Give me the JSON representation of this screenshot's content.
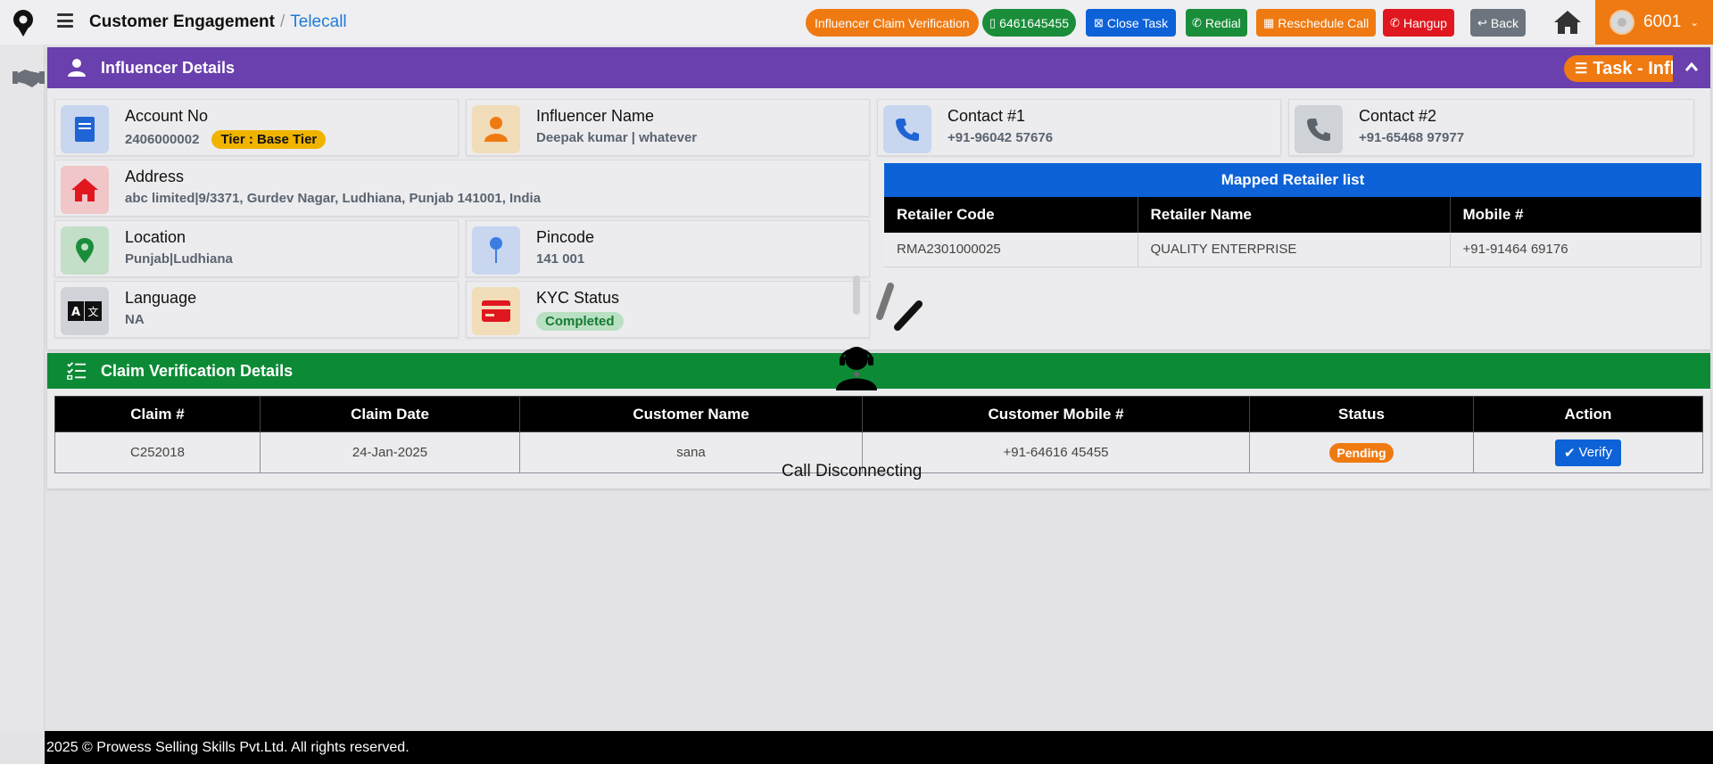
{
  "header": {
    "title": "Customer Engagement",
    "separator": "/",
    "subtitle": "Telecall",
    "buttons": {
      "influencer_claim": "Influencer Claim Verification",
      "phone": "6461645455",
      "close_task": "Close Task",
      "redial": "Redial",
      "reschedule": "Reschedule Call",
      "hangup": "Hangup",
      "back": "Back"
    },
    "user_id": "6001"
  },
  "influencer_panel": {
    "title": "Influencer Details",
    "task_label": "Task - Infl",
    "cards": {
      "account_no": {
        "title": "Account No",
        "value": "2406000002",
        "tier": "Tier : Base Tier"
      },
      "influencer_name": {
        "title": "Influencer Name",
        "value": "Deepak kumar | whatever"
      },
      "contact1": {
        "title": "Contact #1",
        "value": "+91-96042 57676"
      },
      "contact2": {
        "title": "Contact #2",
        "value": "+91-65468 97977"
      },
      "address": {
        "title": "Address",
        "value": "abc limited|9/3371, Gurdev Nagar, Ludhiana, Punjab 141001, India"
      },
      "location": {
        "title": "Location",
        "value": "Punjab|Ludhiana"
      },
      "pincode": {
        "title": "Pincode",
        "value": "141 001"
      },
      "language": {
        "title": "Language",
        "value": "NA"
      },
      "kyc": {
        "title": "KYC Status",
        "value": "Completed"
      }
    },
    "retailer_table": {
      "caption": "Mapped Retailer list",
      "headers": [
        "Retailer Code",
        "Retailer Name",
        "Mobile #"
      ],
      "rows": [
        [
          "RMA2301000025",
          "QUALITY ENTERPRISE",
          "+91-91464 69176"
        ]
      ]
    }
  },
  "claim_panel": {
    "title": "Claim Verification Details",
    "headers": [
      "Claim #",
      "Claim Date",
      "Customer Name",
      "Customer Mobile #",
      "Status",
      "Action"
    ],
    "rows": [
      {
        "claim": "C252018",
        "date": "24-Jan-2025",
        "customer": "sana",
        "mobile": "+91-64616 45455",
        "status": "Pending",
        "action": "Verify"
      }
    ]
  },
  "overlay": {
    "message": "Call Disconnecting"
  },
  "footer": {
    "text": "2025 © Prowess Selling Skills Pvt.Ltd. All rights reserved."
  },
  "colors": {
    "purple_header": "#6a3fae",
    "green_header": "#0d8a36",
    "orange": "#ef7a12",
    "blue": "#0d62d8",
    "green_btn": "#1a8d3a",
    "red_btn": "#e0171f",
    "gray_btn": "#6c757d"
  },
  "icons": {
    "logo": "location-pin-logo-icon",
    "home": "home-icon",
    "rail": "handshake-icon",
    "influencer": "user-icon",
    "claim": "checklist-icon",
    "agent": "headset-agent-icon"
  }
}
